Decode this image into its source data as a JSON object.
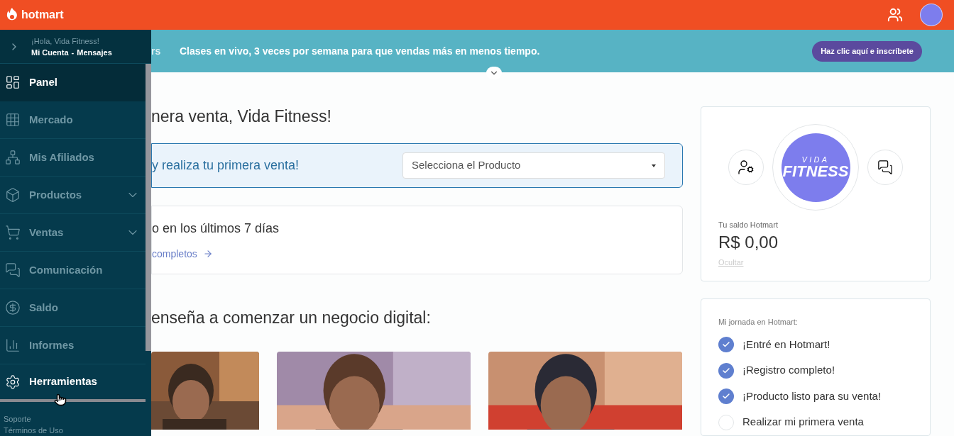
{
  "topbar": {
    "brand": "hotmart"
  },
  "sidebar": {
    "greeting": "¡Hola, Vida Fitness!",
    "account_link": "Mi Cuenta",
    "separator": "-",
    "messages_link": "Mensajes",
    "items": [
      {
        "label": "Panel",
        "selected": true,
        "hovered": false,
        "expandable": false
      },
      {
        "label": "Mercado",
        "selected": false,
        "hovered": false,
        "expandable": false
      },
      {
        "label": "Mis Afiliados",
        "selected": false,
        "hovered": false,
        "expandable": false
      },
      {
        "label": "Productos",
        "selected": false,
        "hovered": false,
        "expandable": true
      },
      {
        "label": "Ventas",
        "selected": false,
        "hovered": false,
        "expandable": true
      },
      {
        "label": "Comunicación",
        "selected": false,
        "hovered": false,
        "expandable": false
      },
      {
        "label": "Saldo",
        "selected": false,
        "hovered": false,
        "expandable": false
      },
      {
        "label": "Informes",
        "selected": false,
        "hovered": false,
        "expandable": false
      },
      {
        "label": "Herramientas",
        "selected": false,
        "hovered": true,
        "expandable": false
      }
    ],
    "footer_links": [
      "Soporte",
      "Términos de Uso"
    ]
  },
  "banner": {
    "partial_text": "rs",
    "text": "Clases en vivo, 3 veces por semana para que vendas más en menos tiempo.",
    "button": "Haz clic aquí e inscríbete"
  },
  "main": {
    "heading": "nera venta, Vida Fitness!",
    "sale_card": {
      "text": "y realiza tu primera venta!",
      "select_placeholder": "Selecciona el Producto"
    },
    "summary_card": {
      "text": "o en los últimos 7 días",
      "link": "completos"
    },
    "section_heading": "enseña a comenzar un negocio digital:"
  },
  "profile": {
    "logo": {
      "top": "VIDA",
      "bottom": "FITNESS"
    },
    "balance_label": "Tu saldo Hotmart",
    "balance": "R$ 0,00",
    "hide_link": "Ocultar"
  },
  "journey": {
    "title": "Mi jornada en Hotmart:",
    "steps": [
      {
        "label": "¡Entré en Hotmart!",
        "checked": true
      },
      {
        "label": "¡Registro completo!",
        "checked": true
      },
      {
        "label": "¡Producto listo para su venta!",
        "checked": true
      },
      {
        "label": "Realizar mi primera venta",
        "checked": false
      }
    ]
  }
}
